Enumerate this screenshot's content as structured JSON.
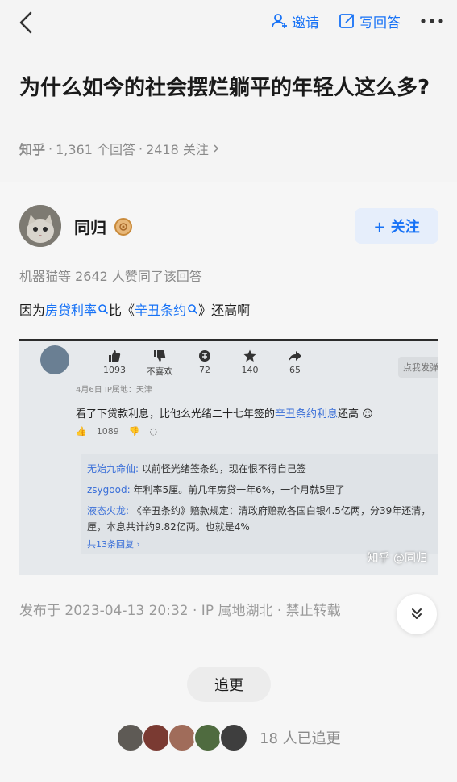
{
  "topbar": {
    "invite_label": "邀请",
    "write_label": "写回答"
  },
  "question": {
    "title": "为什么如今的社会摆烂躺平的年轻人这么多?",
    "brand": "知乎",
    "answers": "1,361 个回答",
    "followers": "2418 关注"
  },
  "answer": {
    "author": "同归",
    "follow_label": "+ 关注",
    "likes_line": "机器猫等 2642 人赞同了该回答",
    "text_prefix": "因为",
    "link1": "房贷利率",
    "text_mid": "比",
    "link2_open": "《",
    "link2": "辛丑条约",
    "link2_close": "》",
    "text_suffix": "还高啊",
    "publish": "发布于 2023-04-13 20:32 · IP 属地湖北 · 禁止转载",
    "zhuigeng_label": "追更",
    "followers_text": "18 人已追更"
  },
  "screenshot": {
    "icons": [
      {
        "name": "thumb-up-icon",
        "count": "1093"
      },
      {
        "name": "thumb-down-icon",
        "count": "不喜欢"
      },
      {
        "name": "coin-icon",
        "count": "72"
      },
      {
        "name": "star-icon",
        "count": "140"
      },
      {
        "name": "share-icon",
        "count": "65"
      }
    ],
    "send_button": "点我发弹",
    "date": "4月6日 IP属地：天津",
    "text_main": "看了下贷款利息，比他么光绪二十七年签的",
    "text_link": "辛丑条约利息",
    "text_end": "还高",
    "like_count": "1089",
    "replies": [
      {
        "name": "无始九命仙:",
        "text": " 以前怪光绪签条约，现在恨不得自己签"
      },
      {
        "name": "zsygood:",
        "text": " 年利率5厘。前几年房贷一年6%，一个月就5里了"
      },
      {
        "name": "液态火龙:",
        "text": " 《辛丑条约》赔款规定：清政府赔款各国白银4.5亿两，分39年还清，"
      },
      {
        "name": "",
        "text": "厘，本息共计约9.82亿两。也就是4%"
      }
    ],
    "more_replies": "共13条回复 ›",
    "watermark": "知乎 @同归"
  },
  "colors": {
    "accent": "#1772f6",
    "meta": "#8a8a8a"
  }
}
